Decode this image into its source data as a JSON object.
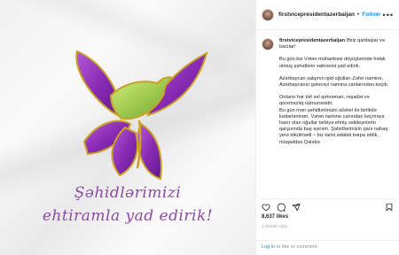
{
  "post": {
    "image_caption_line1": "Şəhidlərimizi",
    "image_caption_line2": "ehtiramla yad edirik!"
  },
  "header": {
    "username": "firstvicepresidentazerbaijan",
    "separator": "•",
    "follow_label": "Follow",
    "more_label": "•••"
  },
  "caption": {
    "username": "firstvicepresidentazerbaijan",
    "greeting": "Əziz qardaşlar və bacılar!",
    "paragraph1": "Bu gün biz Vətən müharibəsi döyüşlərində həlak olmuş şəhidlərin xatirəsini yad edirik.",
    "paragraph2": "Azərbaycan xalqının igid oğulları Zəfər naminə, Azərbaycanın gələcəyi namina canlarından keçib.",
    "paragraph3": "Onların hər biri əsl qəhrəman, rəşadət və qorxmazlıq nümunəsidir.",
    "paragraph4": "Bu gün mən şəhidlərimizin ailələri ilə birlikdə kədərlənirəm. Vətən namine canından keçməyə hazır olan oğullar tərbiyə etmiş valideynlərin qarşısında baş əyirəm. Şəhidlərimizin qanı nahaq yerə tökülmədi – biz tarixi ədaləti bərpa etdik, müqəddəs Qələbə"
  },
  "stats": {
    "likes": "8,637 likes",
    "time_ago": "1 HOUR AGO"
  },
  "login": {
    "login_link": "Log in",
    "rest": " to like or comment."
  },
  "colors": {
    "accent": "#0095f6",
    "flower_purple": "#8a2bb5",
    "flower_green": "#8dc63f",
    "gold": "#c9a227"
  }
}
